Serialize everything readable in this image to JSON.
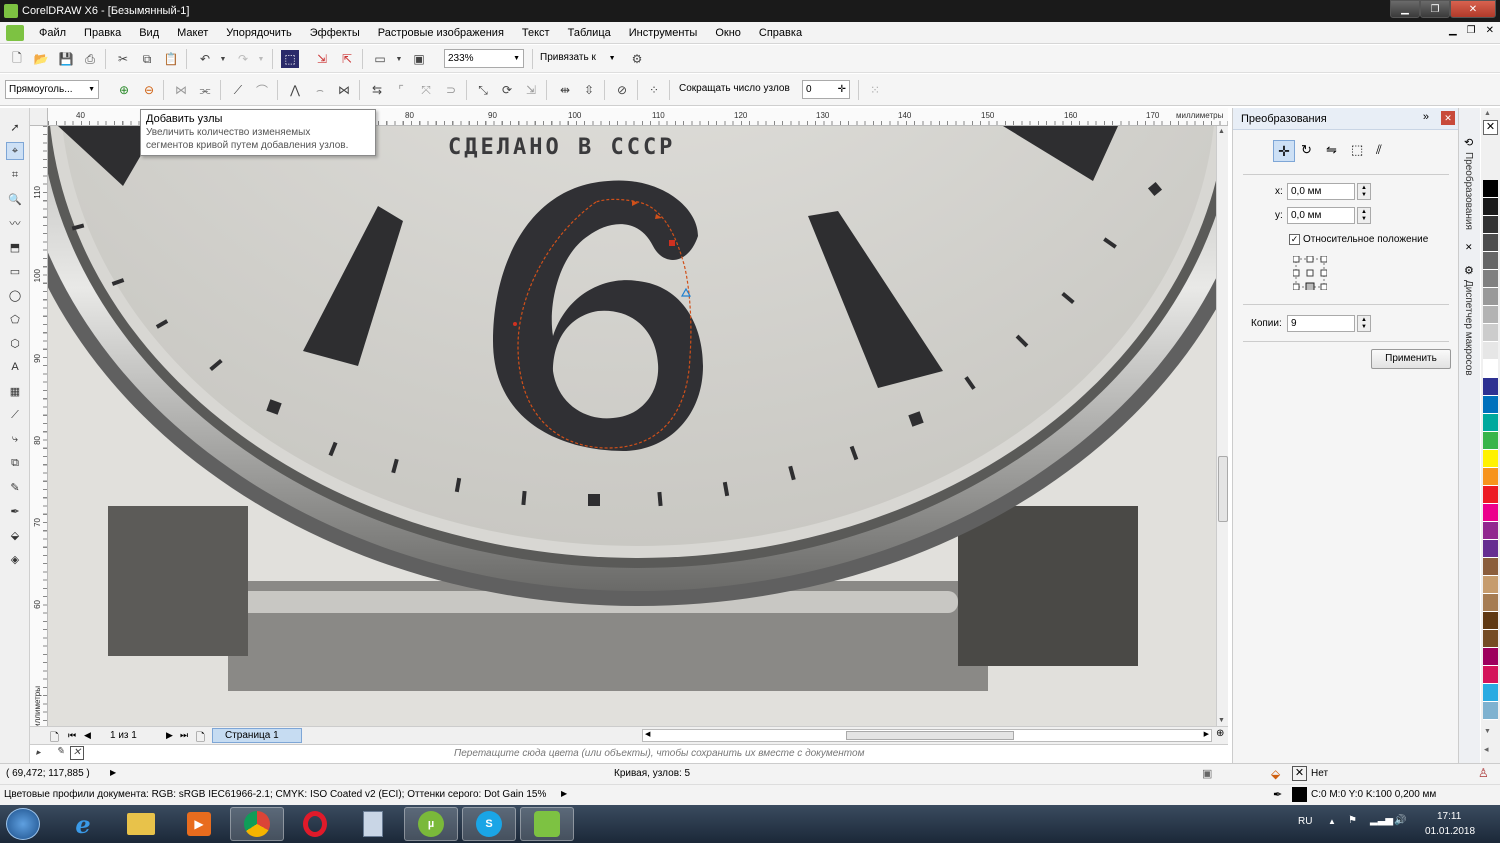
{
  "window": {
    "title": "CorelDRAW X6 - [Безымянный-1]"
  },
  "menu": [
    "Файл",
    "Правка",
    "Вид",
    "Макет",
    "Упорядочить",
    "Эффекты",
    "Растровые изображения",
    "Текст",
    "Таблица",
    "Инструменты",
    "Окно",
    "Справка"
  ],
  "toolbar1": {
    "zoom": "233%",
    "snap_label": "Привязать к"
  },
  "toolbar2": {
    "shape_combo": "Прямоуголь...",
    "reduce_nodes_label": "Сокращать число узлов",
    "reduce_nodes_value": "0"
  },
  "tooltip": {
    "title": "Добавить узлы",
    "body_line1": "Увеличить количество изменяемых",
    "body_line2": "сегментов кривой путем добавления узлов."
  },
  "ruler": {
    "h_ticks": [
      "40",
      "80",
      "90",
      "100",
      "110",
      "120",
      "130",
      "140",
      "150",
      "160",
      "170"
    ],
    "h_unit": "миллиметры",
    "v_ticks": [
      "110",
      "100",
      "90",
      "80",
      "70",
      "60"
    ],
    "v_unit": "миллиметры"
  },
  "canvas": {
    "dial_text": "СДЕЛАНО В СССР",
    "numeral": "6"
  },
  "pages": {
    "counter": "1 из 1",
    "tab": "Страница 1"
  },
  "hint": "Перетащите сюда цвета (или объекты), чтобы сохранить их вместе с документом",
  "docker": {
    "title": "Преобразования",
    "x_label": "x:",
    "x_value": "0,0 мм",
    "y_label": "y:",
    "y_value": "0,0 мм",
    "relative_label": "Относительное положение",
    "copies_label": "Копии:",
    "copies_value": "9",
    "apply_label": "Применить"
  },
  "docker_tabs": [
    "Преобразования",
    "Диспетчер макросов"
  ],
  "palette": [
    "#000000",
    "#1a1a1a",
    "#333333",
    "#4d4d4d",
    "#666666",
    "#808080",
    "#999999",
    "#b3b3b3",
    "#cccccc",
    "#e6e6e6",
    "#ffffff",
    "#2e3192",
    "#0071bc",
    "#00a99d",
    "#39b54a",
    "#fff200",
    "#f7941d",
    "#ed1c24",
    "#ec008c",
    "#92278f",
    "#662d91",
    "#8b5e3c",
    "#c69c6d",
    "#a67c52",
    "#603913",
    "#754c24",
    "#9e005d",
    "#d4145a",
    "#29abe2",
    "#7fb2d0"
  ],
  "status": {
    "coords": "( 69,472; 117,885 )",
    "object_info": "Кривая, узлов: 5",
    "fill_label": "Нет",
    "profiles": "Цветовые профили документа: RGB: sRGB IEC61966-2.1; CMYK: ISO Coated v2 (ECI); Оттенки серого: Dot Gain 15%",
    "outline": "C:0 M:0 Y:0 K:100  0,200 мм"
  },
  "taskbar": {
    "lang": "RU",
    "time": "17:11",
    "date": "01.01.2018"
  }
}
